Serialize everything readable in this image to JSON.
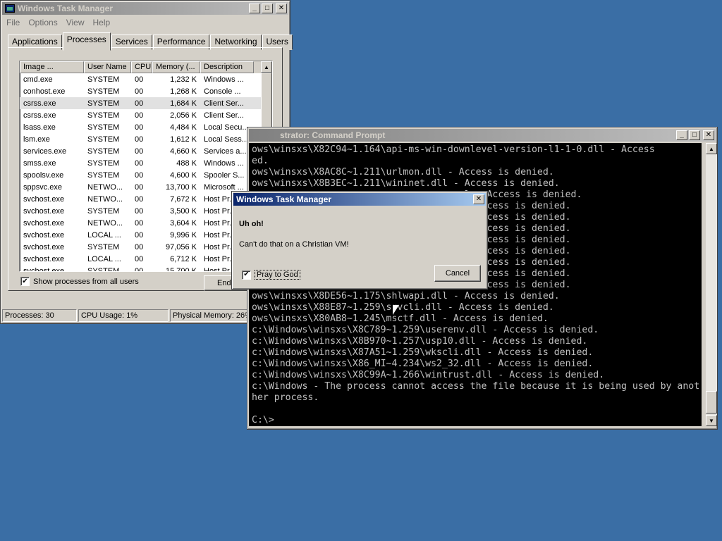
{
  "taskmgr": {
    "title": "Windows Task Manager",
    "menu": [
      "File",
      "Options",
      "View",
      "Help"
    ],
    "tabs": [
      "Applications",
      "Processes",
      "Services",
      "Performance",
      "Networking",
      "Users"
    ],
    "selected_tab": "Processes",
    "columns": [
      "Image ...",
      "User Name",
      "CPU",
      "Memory (...",
      "Description"
    ],
    "rows": [
      {
        "image": "cmd.exe",
        "user": "SYSTEM",
        "cpu": "00",
        "mem": "1,232 K",
        "desc": "Windows ..."
      },
      {
        "image": "conhost.exe",
        "user": "SYSTEM",
        "cpu": "00",
        "mem": "1,268 K",
        "desc": "Console ..."
      },
      {
        "image": "csrss.exe",
        "user": "SYSTEM",
        "cpu": "00",
        "mem": "1,684 K",
        "desc": "Client Ser..."
      },
      {
        "image": "csrss.exe",
        "user": "SYSTEM",
        "cpu": "00",
        "mem": "2,056 K",
        "desc": "Client Ser..."
      },
      {
        "image": "lsass.exe",
        "user": "SYSTEM",
        "cpu": "00",
        "mem": "4,484 K",
        "desc": "Local Secu..."
      },
      {
        "image": "lsm.exe",
        "user": "SYSTEM",
        "cpu": "00",
        "mem": "1,612 K",
        "desc": "Local Sess..."
      },
      {
        "image": "services.exe",
        "user": "SYSTEM",
        "cpu": "00",
        "mem": "4,660 K",
        "desc": "Services a..."
      },
      {
        "image": "smss.exe",
        "user": "SYSTEM",
        "cpu": "00",
        "mem": "488 K",
        "desc": "Windows ..."
      },
      {
        "image": "spoolsv.exe",
        "user": "SYSTEM",
        "cpu": "00",
        "mem": "4,600 K",
        "desc": "Spooler S..."
      },
      {
        "image": "sppsvc.exe",
        "user": "NETWO...",
        "cpu": "00",
        "mem": "13,700 K",
        "desc": "Microsoft ..."
      },
      {
        "image": "svchost.exe",
        "user": "NETWO...",
        "cpu": "00",
        "mem": "7,672 K",
        "desc": "Host Pr..."
      },
      {
        "image": "svchost.exe",
        "user": "SYSTEM",
        "cpu": "00",
        "mem": "3,500 K",
        "desc": "Host Pr..."
      },
      {
        "image": "svchost.exe",
        "user": "NETWO...",
        "cpu": "00",
        "mem": "3,604 K",
        "desc": "Host Pr..."
      },
      {
        "image": "svchost.exe",
        "user": "LOCAL ...",
        "cpu": "00",
        "mem": "9,996 K",
        "desc": "Host Pr..."
      },
      {
        "image": "svchost.exe",
        "user": "SYSTEM",
        "cpu": "00",
        "mem": "97,056 K",
        "desc": "Host Pr..."
      },
      {
        "image": "svchost.exe",
        "user": "LOCAL ...",
        "cpu": "00",
        "mem": "6,712 K",
        "desc": "Host Pr..."
      },
      {
        "image": "svchost.exe",
        "user": "SYSTEM",
        "cpu": "00",
        "mem": "15,700 K",
        "desc": "Host Pr..."
      }
    ],
    "show_all_label": "Show processes from all users",
    "show_all_checked": true,
    "end_button": "End",
    "status": {
      "processes": "Processes: 30",
      "cpu": "CPU Usage: 1%",
      "memory": "Physical Memory: 26%"
    }
  },
  "console": {
    "title": "strator: Command Prompt",
    "lines": [
      "ows\\winsxs\\X82C94~1.164\\api-ms-win-downlevel-version-l1-1-0.dll - Access",
      "ed.",
      "ows\\winsxs\\X8AC8C~1.211\\urlmon.dll - Access is denied.",
      "ows\\winsxs\\X8B3EC~1.211\\wininet.dll - Access is denied.",
      "                                      l - Access is denied.",
      "                                      - Access is denied.",
      "                                      - Access is denied.",
      "                                      - Access is denied.",
      "                                      - Access is denied.",
      "                                      - Access is denied.",
      "                                      - Access is denied.",
      "                                      - Access is denied.",
      "                                      - Access is denied.",
      "ows\\winsxs\\X8DE56~1.175\\shlwapi.dll - Access is denied.",
      "ows\\winsxs\\X88E87~1.259\\srvcli.dll - Access is denied.",
      "ows\\winsxs\\X80AB8~1.245\\msctf.dll - Access is denied.",
      "c:\\Windows\\winsxs\\X8C789~1.259\\userenv.dll - Access is denied.",
      "c:\\Windows\\winsxs\\X8B970~1.257\\usp10.dll - Access is denied.",
      "c:\\Windows\\winsxs\\X87A51~1.259\\wkscli.dll - Access is denied.",
      "c:\\Windows\\winsxs\\X86_MI~4.234\\ws2_32.dll - Access is denied.",
      "c:\\Windows\\winsxs\\X8C99A~1.266\\wintrust.dll - Access is denied.",
      "c:\\Windows - The process cannot access the file because it is being used by anot",
      "her process.",
      "",
      "C:\\>"
    ]
  },
  "dialog": {
    "title": "Windows Task Manager",
    "heading": "Uh oh!",
    "message": "Can't do that on a Christian VM!",
    "checkbox_label": "Pray to God",
    "checkbox_checked": true,
    "cancel_button": "Cancel"
  },
  "colors": {
    "desktop": "#3a6ea5",
    "active_title": "#0a246a",
    "inactive_title": "#808080"
  }
}
